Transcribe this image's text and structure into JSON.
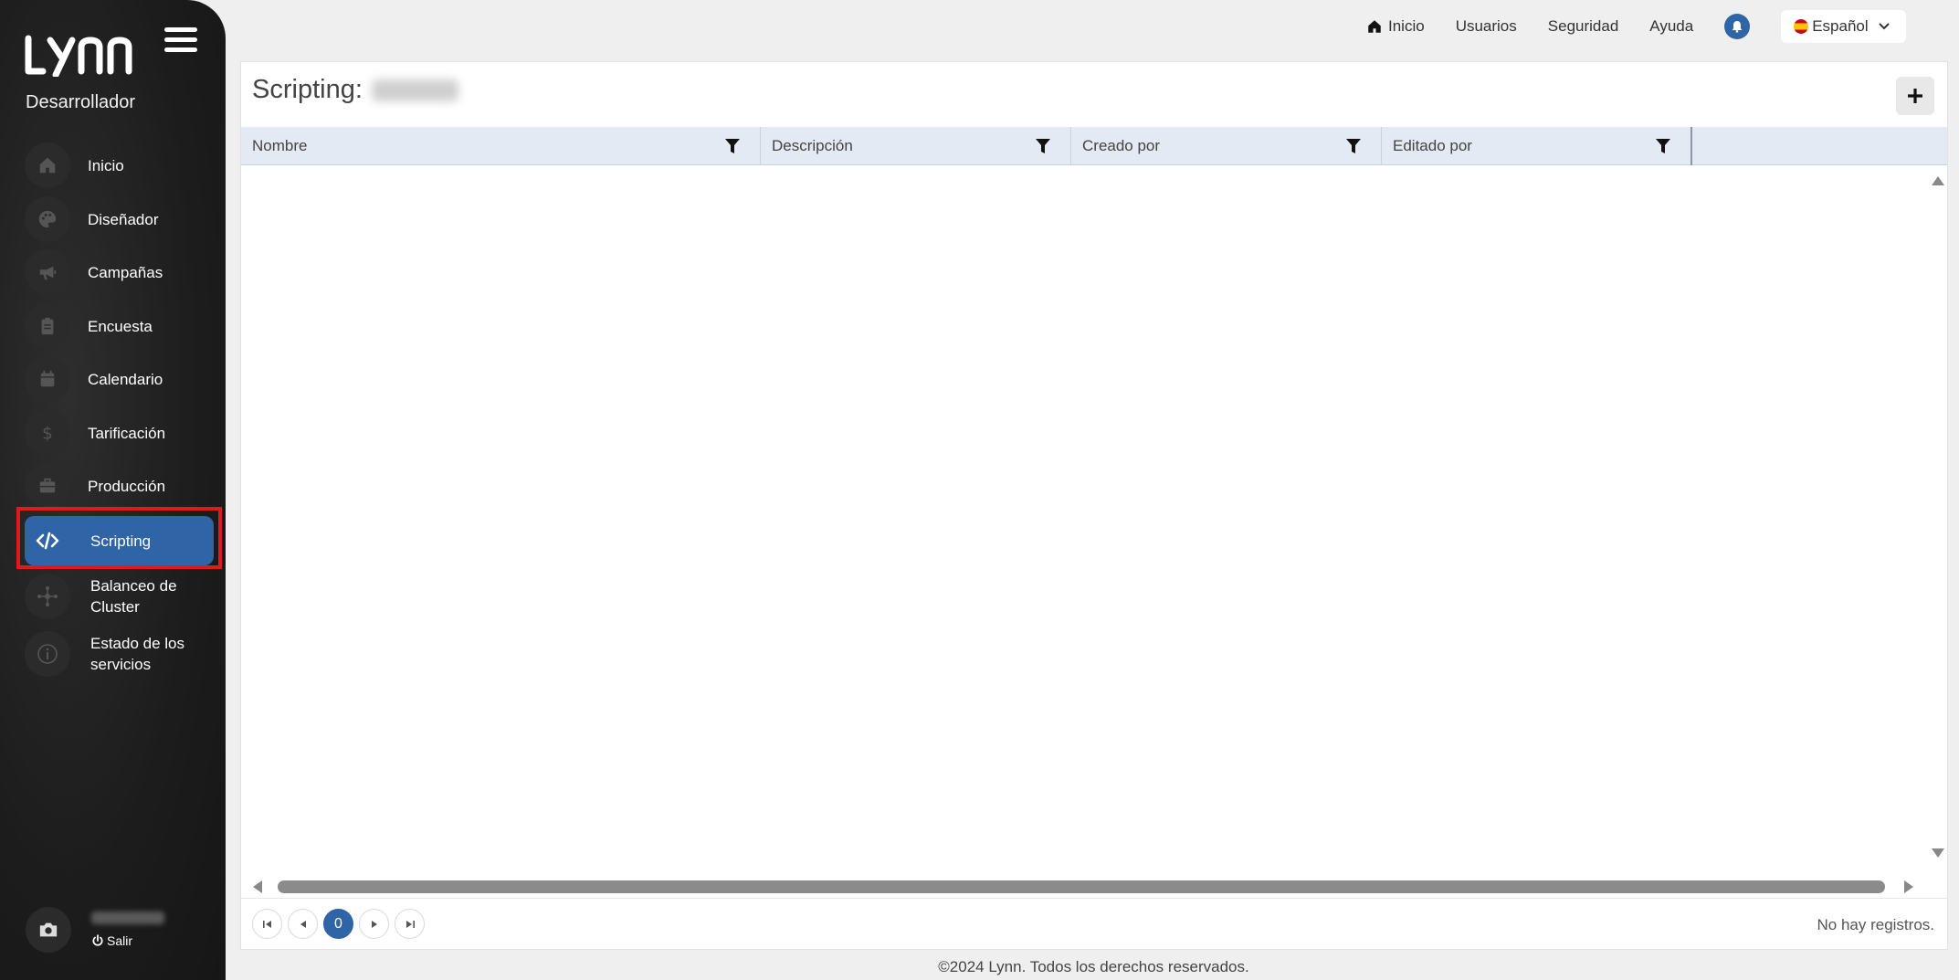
{
  "sidebar": {
    "brand": "LYNN",
    "role": "Desarrollador",
    "items": [
      {
        "label": "Inicio",
        "icon": "home-icon"
      },
      {
        "label": "Diseñador",
        "icon": "palette-icon"
      },
      {
        "label": "Campañas",
        "icon": "megaphone-icon"
      },
      {
        "label": "Encuesta",
        "icon": "clipboard-icon"
      },
      {
        "label": "Calendario",
        "icon": "calendar-icon"
      },
      {
        "label": "Tarificación",
        "icon": "dollar-icon"
      },
      {
        "label": "Producción",
        "icon": "briefcase-icon"
      },
      {
        "label": "Scripting",
        "icon": "code-icon",
        "active": true
      },
      {
        "label": "Balanceo de Cluster",
        "icon": "cluster-icon"
      },
      {
        "label": "Estado de los servicios",
        "icon": "info-icon"
      }
    ],
    "user": {
      "logout_label": "Salir"
    }
  },
  "topnav": {
    "home": "Inicio",
    "users": "Usuarios",
    "security": "Seguridad",
    "help": "Ayuda",
    "language": "Español"
  },
  "main": {
    "title": "Scripting:",
    "columns": [
      "Nombre",
      "Descripción",
      "Creado por",
      "Editado por"
    ],
    "pager": {
      "current_page": "0"
    },
    "empty_text": "No hay registros."
  },
  "footer": "©2024 Lynn. Todos los derechos reservados.",
  "colors": {
    "accent": "#2f65a6",
    "sidebar": "#1c1c1c",
    "highlight": "#e0191d"
  }
}
